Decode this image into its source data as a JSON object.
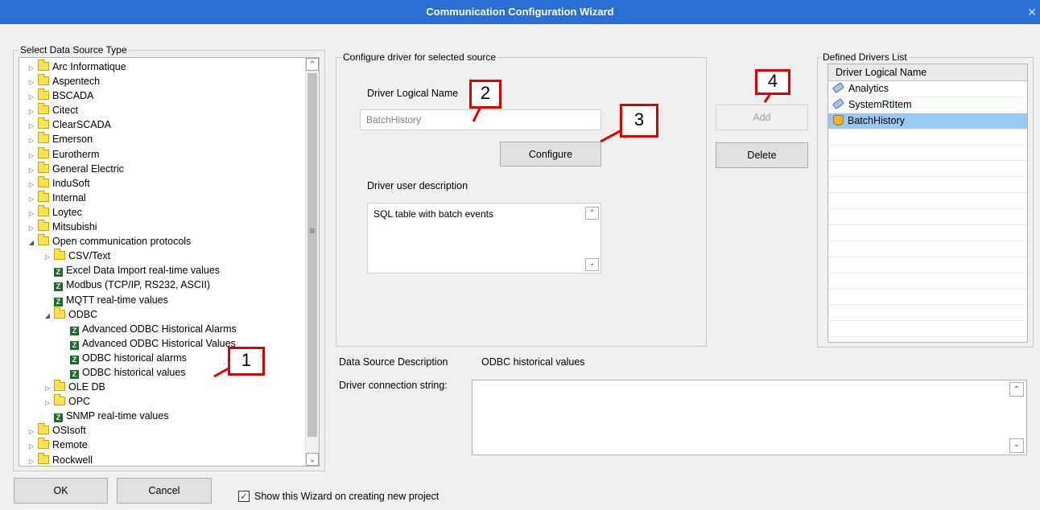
{
  "window": {
    "title": "Communication Configuration Wizard",
    "close_glyph": "✕"
  },
  "source_panel": {
    "legend": "Select Data Source Type",
    "tree": [
      {
        "label": "Arc Informatique",
        "level": 0,
        "kind": "folder",
        "state": "collapsed"
      },
      {
        "label": "Aspentech",
        "level": 0,
        "kind": "folder",
        "state": "collapsed"
      },
      {
        "label": "BSCADA",
        "level": 0,
        "kind": "folder",
        "state": "collapsed"
      },
      {
        "label": "Citect",
        "level": 0,
        "kind": "folder",
        "state": "collapsed"
      },
      {
        "label": "ClearSCADA",
        "level": 0,
        "kind": "folder",
        "state": "collapsed"
      },
      {
        "label": "Emerson",
        "level": 0,
        "kind": "folder",
        "state": "collapsed"
      },
      {
        "label": "Eurotherm",
        "level": 0,
        "kind": "folder",
        "state": "collapsed"
      },
      {
        "label": "General Electric",
        "level": 0,
        "kind": "folder",
        "state": "collapsed"
      },
      {
        "label": "InduSoft",
        "level": 0,
        "kind": "folder",
        "state": "collapsed"
      },
      {
        "label": "Internal",
        "level": 0,
        "kind": "folder",
        "state": "collapsed"
      },
      {
        "label": "Loytec",
        "level": 0,
        "kind": "folder",
        "state": "collapsed"
      },
      {
        "label": "Mitsubishi",
        "level": 0,
        "kind": "folder",
        "state": "collapsed"
      },
      {
        "label": "Open communication protocols",
        "level": 0,
        "kind": "folder",
        "state": "expanded"
      },
      {
        "label": "CSV/Text",
        "level": 1,
        "kind": "folder",
        "state": "collapsed"
      },
      {
        "label": "Excel Data Import real-time values",
        "level": 1,
        "kind": "driver",
        "state": "leaf"
      },
      {
        "label": "Modbus (TCP/IP, RS232, ASCII)",
        "level": 1,
        "kind": "driver",
        "state": "leaf"
      },
      {
        "label": "MQTT real-time values",
        "level": 1,
        "kind": "driver",
        "state": "leaf"
      },
      {
        "label": "ODBC",
        "level": 1,
        "kind": "folder",
        "state": "expanded"
      },
      {
        "label": "Advanced ODBC Historical Alarms",
        "level": 2,
        "kind": "driver",
        "state": "leaf"
      },
      {
        "label": "Advanced ODBC Historical Values",
        "level": 2,
        "kind": "driver",
        "state": "leaf"
      },
      {
        "label": "ODBC historical alarms",
        "level": 2,
        "kind": "driver",
        "state": "leaf"
      },
      {
        "label": "ODBC historical values",
        "level": 2,
        "kind": "driver",
        "state": "leaf"
      },
      {
        "label": "OLE DB",
        "level": 1,
        "kind": "folder",
        "state": "collapsed"
      },
      {
        "label": "OPC",
        "level": 1,
        "kind": "folder",
        "state": "collapsed"
      },
      {
        "label": "SNMP real-time values",
        "level": 1,
        "kind": "driver",
        "state": "leaf"
      },
      {
        "label": "OSIsoft",
        "level": 0,
        "kind": "folder",
        "state": "collapsed"
      },
      {
        "label": "Remote",
        "level": 0,
        "kind": "folder",
        "state": "collapsed"
      },
      {
        "label": "Rockwell",
        "level": 0,
        "kind": "folder",
        "state": "collapsed"
      }
    ],
    "scroll_up": "⌃",
    "scroll_down": "⌄",
    "scroll_grip": "≡"
  },
  "config_panel": {
    "legend": "Configure driver for selected source",
    "name_label": "Driver Logical Name",
    "name_value": "BatchHistory",
    "configure_button": "Configure",
    "desc_label": "Driver user description",
    "desc_value": "SQL table with batch events",
    "scroll_up": "⌃",
    "scroll_down": "⌄"
  },
  "actions": {
    "add": "Add",
    "delete": "Delete"
  },
  "drivers_panel": {
    "legend": "Defined Drivers List",
    "column": "Driver Logical Name",
    "rows": [
      {
        "label": "Analytics",
        "icon": "tag-icon",
        "selected": false
      },
      {
        "label": "SystemRtItem",
        "icon": "tag-icon",
        "selected": false
      },
      {
        "label": "BatchHistory",
        "icon": "database-icon",
        "selected": true
      }
    ],
    "empty_rows": 13
  },
  "source_description": {
    "label": "Data Source Description",
    "value": "ODBC historical values"
  },
  "connection_string": {
    "label": "Driver connection string:",
    "value": "",
    "scroll_up": "⌃",
    "scroll_down": "⌄"
  },
  "footer": {
    "ok": "OK",
    "cancel": "Cancel",
    "checkbox_label": "Show this Wizard on creating new project",
    "checkbox_checked": true,
    "check_glyph": "✓"
  },
  "markers": [
    "1",
    "2",
    "3",
    "4"
  ]
}
